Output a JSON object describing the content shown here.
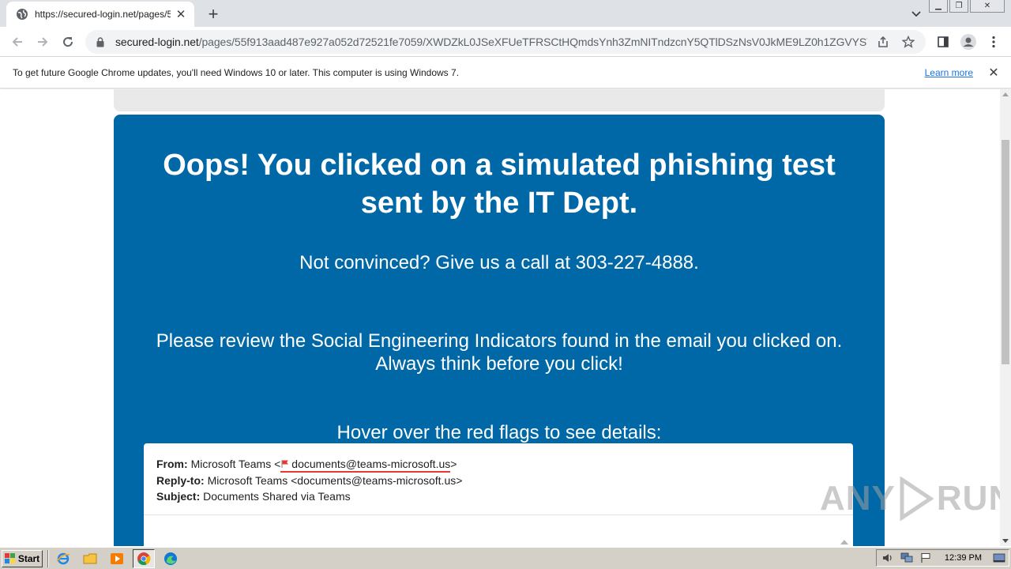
{
  "browser": {
    "tab": {
      "title": "https://secured-login.net/pages/55f913aad487e927a052d72521fe7059"
    },
    "omnibox": {
      "host": "secured-login.net",
      "path": "/pages/55f913aad487e927a052d72521fe7059/XWDZkL0JSeXFUeTFRSCtHQmdsYnh3ZmNITndzcnY5QTlDSzNsV0JkME9LZ0h1ZGVYSTlR..."
    },
    "infobar": {
      "message": "To get future Google Chrome updates, you'll need Windows 10 or later. This computer is using Windows 7.",
      "link": "Learn more"
    }
  },
  "page": {
    "title": "Oops! You clicked on a simulated phishing test sent by the IT Dept.",
    "call_text": "Not convinced?  Give us a call at 303-227-4888.",
    "review_line1": "Please review the Social Engineering Indicators found in the email you clicked on.",
    "review_line2": "Always think before you click!",
    "hover_text": "Hover over the red flags to see details:",
    "email": {
      "from_label": "From:",
      "from_name": "Microsoft Teams <",
      "from_address": "documents@teams-microsoft.us",
      "from_close": ">",
      "replyto_label": "Reply-to:",
      "replyto_value": "Microsoft Teams <documents@teams-microsoft.us>",
      "subject_label": "Subject:",
      "subject_value": "Documents Shared via Teams"
    },
    "flag_color": "#e53935",
    "card_color": "#0068a7"
  },
  "watermark": {
    "left": "ANY",
    "right": "RUN"
  },
  "taskbar": {
    "start_label": "Start",
    "clock": "12:39 PM",
    "apps": [
      "ie-icon",
      "explorer-icon",
      "media-player-icon",
      "chrome-icon",
      "edge-icon"
    ]
  }
}
